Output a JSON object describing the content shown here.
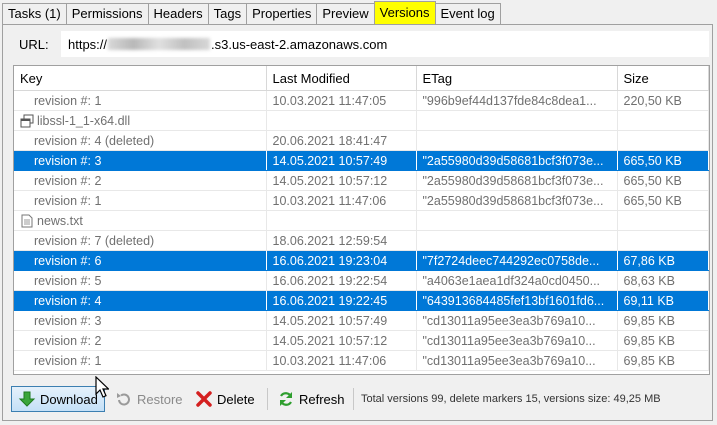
{
  "tabs": [
    {
      "label": "Tasks (1)",
      "active": false
    },
    {
      "label": "Permissions",
      "active": false
    },
    {
      "label": "Headers",
      "active": false
    },
    {
      "label": "Tags",
      "active": false
    },
    {
      "label": "Properties",
      "active": false
    },
    {
      "label": "Preview",
      "active": false
    },
    {
      "label": "Versions",
      "active": true
    },
    {
      "label": "Event log",
      "active": false
    }
  ],
  "url": {
    "label": "URL:",
    "prefix": "https://",
    "suffix": ".s3.us-east-2.amazonaws.com"
  },
  "columns": [
    "Key",
    "Last Modified",
    "ETag",
    "Size"
  ],
  "rows": [
    {
      "type": "revision",
      "key": "revision #: 1",
      "modified": "10.03.2021 11:47:05",
      "etag": "\"996b9ef44d137fde84c8dea1...",
      "size": "220,50 KB",
      "selected": false
    },
    {
      "type": "file",
      "icon": "dll-file-icon",
      "key": "libssl-1_1-x64.dll",
      "modified": "",
      "etag": "",
      "size": "",
      "selected": false
    },
    {
      "type": "revision",
      "key": "revision #: 4 (deleted)",
      "modified": "20.06.2021 18:41:47",
      "etag": "",
      "size": "",
      "selected": false
    },
    {
      "type": "revision",
      "key": "revision #: 3",
      "modified": "14.05.2021 10:57:49",
      "etag": "\"2a55980d39d58681bcf3f073e...",
      "size": "665,50 KB",
      "selected": true
    },
    {
      "type": "revision",
      "key": "revision #: 2",
      "modified": "14.05.2021 10:57:12",
      "etag": "\"2a55980d39d58681bcf3f073e...",
      "size": "665,50 KB",
      "selected": false
    },
    {
      "type": "revision",
      "key": "revision #: 1",
      "modified": "10.03.2021 11:47:06",
      "etag": "\"2a55980d39d58681bcf3f073e...",
      "size": "665,50 KB",
      "selected": false
    },
    {
      "type": "file",
      "icon": "text-file-icon",
      "key": "news.txt",
      "modified": "",
      "etag": "",
      "size": "",
      "selected": false
    },
    {
      "type": "revision",
      "key": "revision #: 7 (deleted)",
      "modified": "18.06.2021 12:59:54",
      "etag": "",
      "size": "",
      "selected": false
    },
    {
      "type": "revision",
      "key": "revision #: 6",
      "modified": "16.06.2021 19:23:04",
      "etag": "\"7f2724deec744292ec0758de...",
      "size": "67,86 KB",
      "selected": true
    },
    {
      "type": "revision",
      "key": "revision #: 5",
      "modified": "16.06.2021 19:22:54",
      "etag": "\"a4063e1aea1df324a0cd0450...",
      "size": "68,63 KB",
      "selected": false
    },
    {
      "type": "revision",
      "key": "revision #: 4",
      "modified": "16.06.2021 19:22:45",
      "etag": "\"643913684485fef13bf1601fd6...",
      "size": "69,11 KB",
      "selected": true
    },
    {
      "type": "revision",
      "key": "revision #: 3",
      "modified": "14.05.2021 10:57:49",
      "etag": "\"cd13011a95ee3ea3b769a10...",
      "size": "69,85 KB",
      "selected": false
    },
    {
      "type": "revision",
      "key": "revision #: 2",
      "modified": "14.05.2021 10:57:12",
      "etag": "\"cd13011a95ee3ea3b769a10...",
      "size": "69,85 KB",
      "selected": false
    },
    {
      "type": "revision",
      "key": "revision #: 1",
      "modified": "10.03.2021 11:47:06",
      "etag": "\"cd13011a95ee3ea3b769a10...",
      "size": "69,85 KB",
      "selected": false
    }
  ],
  "toolbar": {
    "download_label": "Download",
    "restore_label": "Restore",
    "delete_label": "Delete",
    "refresh_label": "Refresh",
    "status": "Total versions 99, delete markers 15, versions size: 49,25 MB"
  },
  "colors": {
    "active_tab": "#ffff00",
    "selection": "#0078d7",
    "download_icon": "#3aa53a",
    "delete_icon": "#d42020",
    "refresh_icon": "#2e9e2e"
  }
}
